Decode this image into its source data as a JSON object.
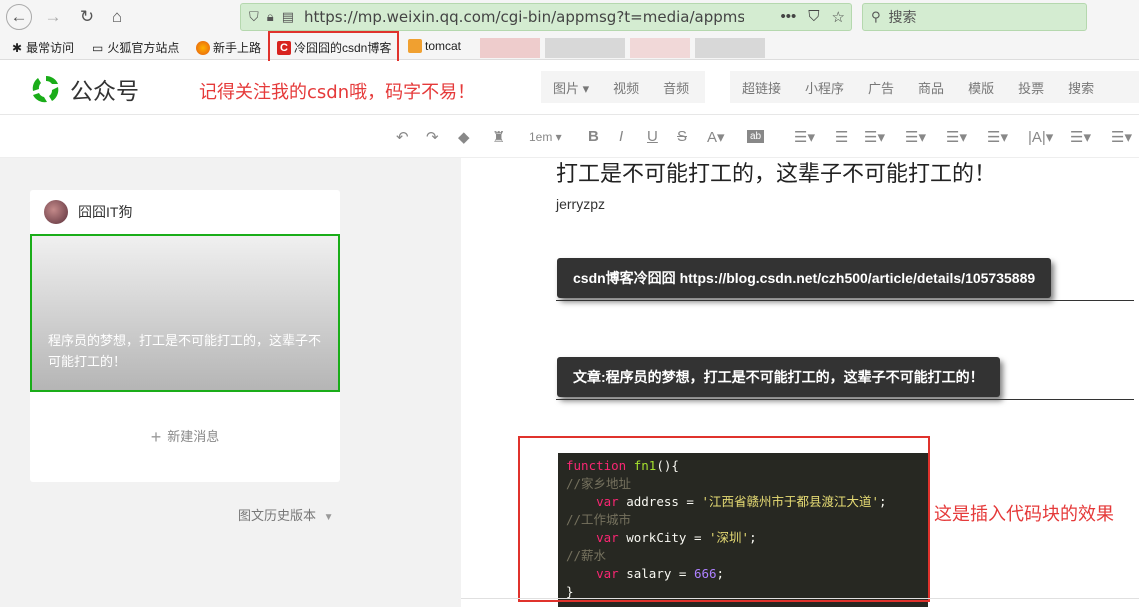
{
  "browser": {
    "url": "https://mp.weixin.qq.com/cgi-bin/appmsg?t=media/appmsg_e",
    "search_placeholder": "搜索",
    "bookmarks": [
      "最常访问",
      "火狐官方站点",
      "新手上路",
      "冷囧囧的csdn博客",
      "tomcat"
    ]
  },
  "header": {
    "logo_text": "公众号",
    "note": "记得关注我的csdn哦，码字不易！",
    "menu_group1": [
      "图片",
      "视频",
      "音频"
    ],
    "menu_group2": [
      "超链接",
      "小程序",
      "广告",
      "商品",
      "模版",
      "投票",
      "搜索"
    ]
  },
  "toolbar": {
    "font_size": "1em"
  },
  "left_panel": {
    "author": "囧囧IT狗",
    "cover_text": "程序员的梦想，打工是不可能打工的，这辈子不可能打工的！",
    "new_message": "新建消息",
    "history": "图文历史版本"
  },
  "article": {
    "title": "打工是不可能打工的，这辈子不可能打工的！",
    "author": "jerryzpz",
    "box1": "csdn博客冷囧囧 https://blog.csdn.net/czh500/article/details/105735889",
    "box2": "文章:程序员的梦想，打工是不可能打工的，这辈子不可能打工的！",
    "side_note": "这是插入代码块的效果"
  },
  "code": {
    "line1_kw": "function",
    "line1_fn": "fn1",
    "line1_rest": "(){",
    "line2": "//家乡地址",
    "line3_kw": "var",
    "line3_var": " address = ",
    "line3_str": "'江西省赣州市于都县渡江大道'",
    "line4": "//工作城市",
    "line5_kw": "var",
    "line5_var": " workCity = ",
    "line5_str": "'深圳'",
    "line6": "//薪水",
    "line7_kw": "var",
    "line7_var": " salary = ",
    "line7_num": "666",
    "line8": "}"
  },
  "colors": {
    "accent_green": "#1aad19",
    "highlight_red": "#e0322c"
  }
}
